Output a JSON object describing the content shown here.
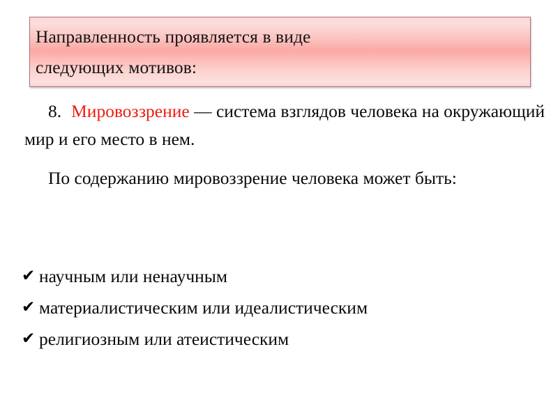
{
  "slide": {
    "background_color": "#ffffff",
    "title_box": {
      "border_color": "#a8707e",
      "gradient_top_color": "#fbd7d6",
      "gradient_mid_color": "#fba8a3",
      "gradient_bottom_color": "#f6d2d4",
      "text": "Направленность проявляется в виде\nследующих мотивов:"
    },
    "body": {
      "accent_color": "#ee1c11",
      "paragraph_1": {
        "number": "8.",
        "term": "Мировоззрение",
        "dash": "—",
        "rest": "система взглядов человека на окружающий мир и его место в нем."
      },
      "paragraph_2": "По содержанию мировоззрение человека может быть:"
    },
    "bullets": {
      "marker": "✔",
      "marker_name": "checkmark-bullet-icon",
      "items": [
        "научным или ненаучным",
        "материалистическим или идеалистическим",
        "религиозным или атеистическим"
      ]
    }
  }
}
